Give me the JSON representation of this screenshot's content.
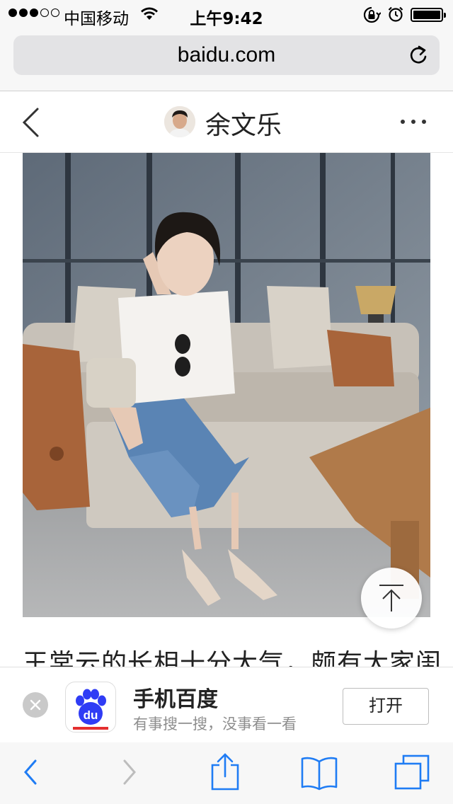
{
  "status_bar": {
    "carrier": "中国移动",
    "time": "上午9:42"
  },
  "browser": {
    "url": "baidu.com"
  },
  "page_header": {
    "author_name": "余文乐"
  },
  "article": {
    "text_preview": "王棠云的长相十分大气，颇有大家闺"
  },
  "app_banner": {
    "app_name": "手机百度",
    "slogan": "有事搜一搜，没事看一看",
    "open_label": "打开",
    "logo_text": "du"
  },
  "colors": {
    "ios_blue": "#1f7cf4",
    "baidu_blue": "#2f3cf5",
    "baidu_red": "#e42f2f"
  },
  "icons": {
    "status": [
      "wifi-icon",
      "orientation-lock-icon",
      "alarm-icon",
      "battery-icon"
    ],
    "toolbar": [
      "back-icon",
      "forward-icon",
      "share-icon",
      "bookmarks-icon",
      "tabs-icon"
    ]
  }
}
